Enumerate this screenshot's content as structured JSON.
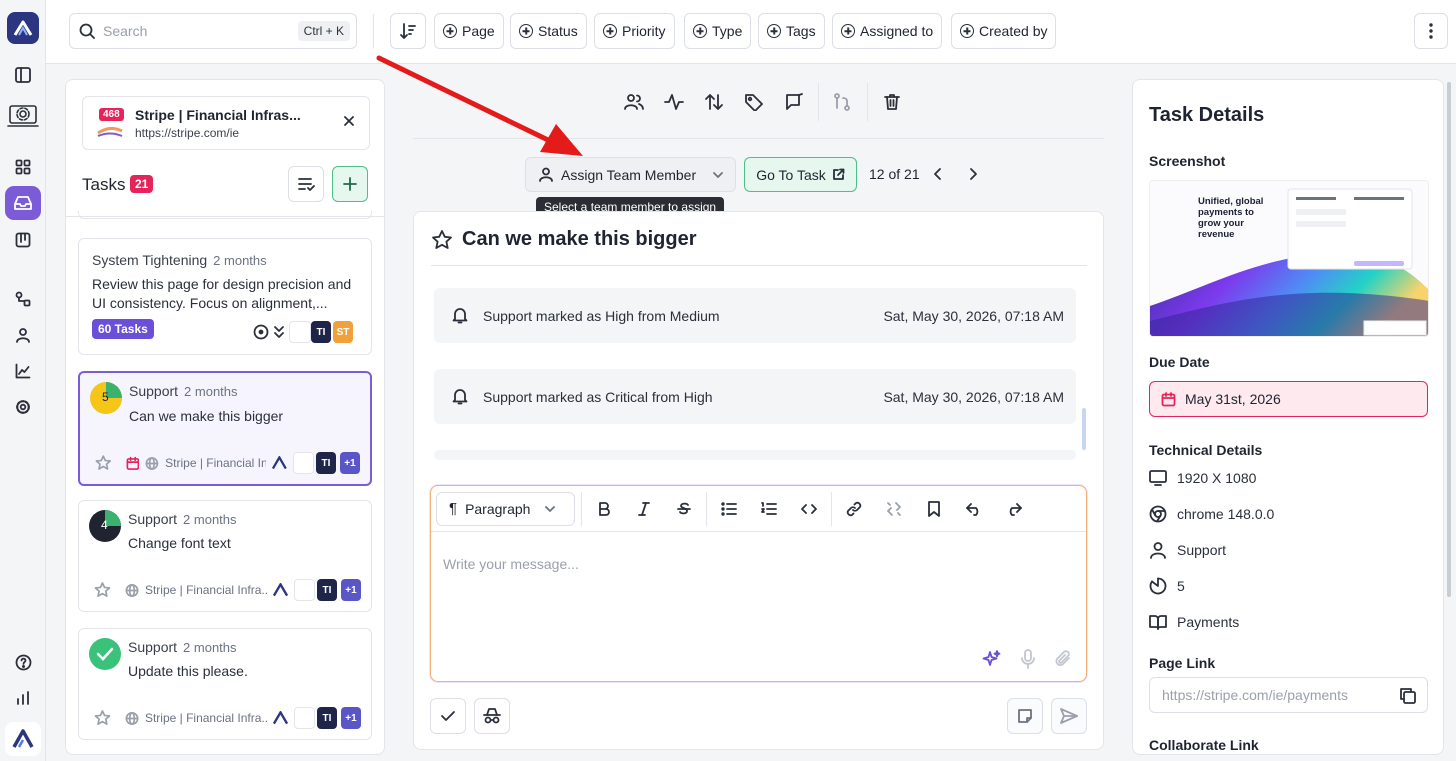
{
  "search": {
    "placeholder": "Search",
    "shortcut": "Ctrl + K"
  },
  "filters": [
    "Page",
    "Status",
    "Priority",
    "Type",
    "Tags",
    "Assigned to",
    "Created by"
  ],
  "site": {
    "badge": "468",
    "name": "Stripe | Financial Infras...",
    "url": "https://stripe.com/ie"
  },
  "tasks": {
    "heading": "Tasks",
    "count": "21"
  },
  "cards": [
    {
      "title": "System Tightening",
      "time": "2 months",
      "desc": "Review this page for design precision and UI consistency. Focus on alignment,...",
      "pill": "60 Tasks",
      "chips": [
        "TI",
        "ST"
      ]
    },
    {
      "title": "Support",
      "time": "2 months",
      "desc": "Can we make this bigger",
      "priority": "5",
      "site": "Stripe | Financial Infr",
      "chips": [
        "TI",
        "+1"
      ]
    },
    {
      "title": "Support",
      "time": "2 months",
      "desc": "Change font text",
      "priority": "4",
      "site": "Stripe | Financial Infra...",
      "chips": [
        "TI",
        "+1"
      ]
    },
    {
      "title": "Support",
      "time": "2 months",
      "desc": "Update this please.",
      "site": "Stripe | Financial Infra...",
      "chips": [
        "TI",
        "+1"
      ]
    }
  ],
  "center": {
    "assign_label": "Assign Team Member",
    "goto_label": "Go To Task",
    "pager": "12 of 21",
    "tooltip": "Select a team member to assign",
    "task_title": "Can we make this bigger",
    "activities": [
      {
        "text": "Support marked as High from Medium",
        "date": "Sat, May 30, 2026, 07:18 AM"
      },
      {
        "text": "Support marked as Critical from High",
        "date": "Sat, May 30, 2026, 07:18 AM"
      }
    ],
    "paragraph_label": "Paragraph",
    "message_placeholder": "Write your message..."
  },
  "details": {
    "title": "Task Details",
    "screenshot_label": "Screenshot",
    "screenshot_headline": "Unified, global payments to grow your revenue",
    "due_label": "Due Date",
    "due_value": "May 31st, 2026",
    "tech_label": "Technical Details",
    "resolution": "1920 X 1080",
    "browser": "chrome 148.0.0",
    "user": "Support",
    "priority": "5",
    "category": "Payments",
    "page_link_label": "Page Link",
    "page_link_placeholder": "https://stripe.com/ie/payments",
    "collab_label": "Collaborate Link"
  },
  "colors": {
    "accent": "#7c5cd6",
    "danger": "#e5245b",
    "success": "#4fbf8a",
    "navy": "#2b3580"
  }
}
